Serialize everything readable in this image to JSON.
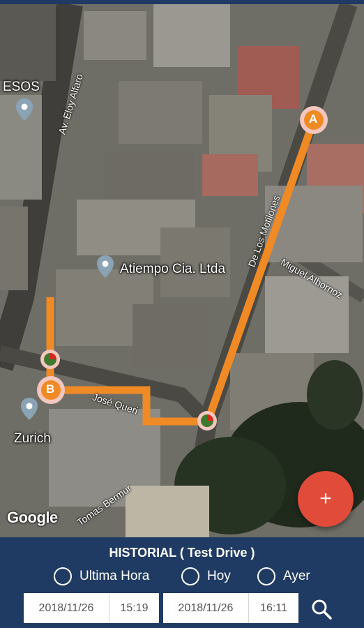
{
  "map": {
    "streets": {
      "av_eloy_alfaro": "Av. Eloy Alfaro",
      "de_los_motilones": "De Los Motilones",
      "miguel_albornoz": "Miguel Albornoz",
      "jose_queri": "José Queri",
      "tomas_bermur": "Tomas Bermur"
    },
    "places": {
      "esos": "ESOS",
      "atiempo": "Atiempo Cia. Ltda",
      "zurich": "Zurich"
    },
    "markers": {
      "start": "A",
      "end": "B"
    },
    "route_color": "#f08a25",
    "attribution": "Google",
    "fab_icon": "+"
  },
  "panel": {
    "title": "HISTORIAL ( Test Drive )",
    "radios": [
      {
        "label": "Ultima Hora",
        "selected": false
      },
      {
        "label": "Hoy",
        "selected": false
      },
      {
        "label": "Ayer",
        "selected": false
      }
    ],
    "from": {
      "date": "2018/11/26",
      "time": "15:19"
    },
    "to": {
      "date": "2018/11/26",
      "time": "16:11"
    },
    "search_icon": "search-icon"
  },
  "colors": {
    "panel_bg": "#1f3a63",
    "fab": "#e04b3a",
    "route": "#f08a25"
  }
}
